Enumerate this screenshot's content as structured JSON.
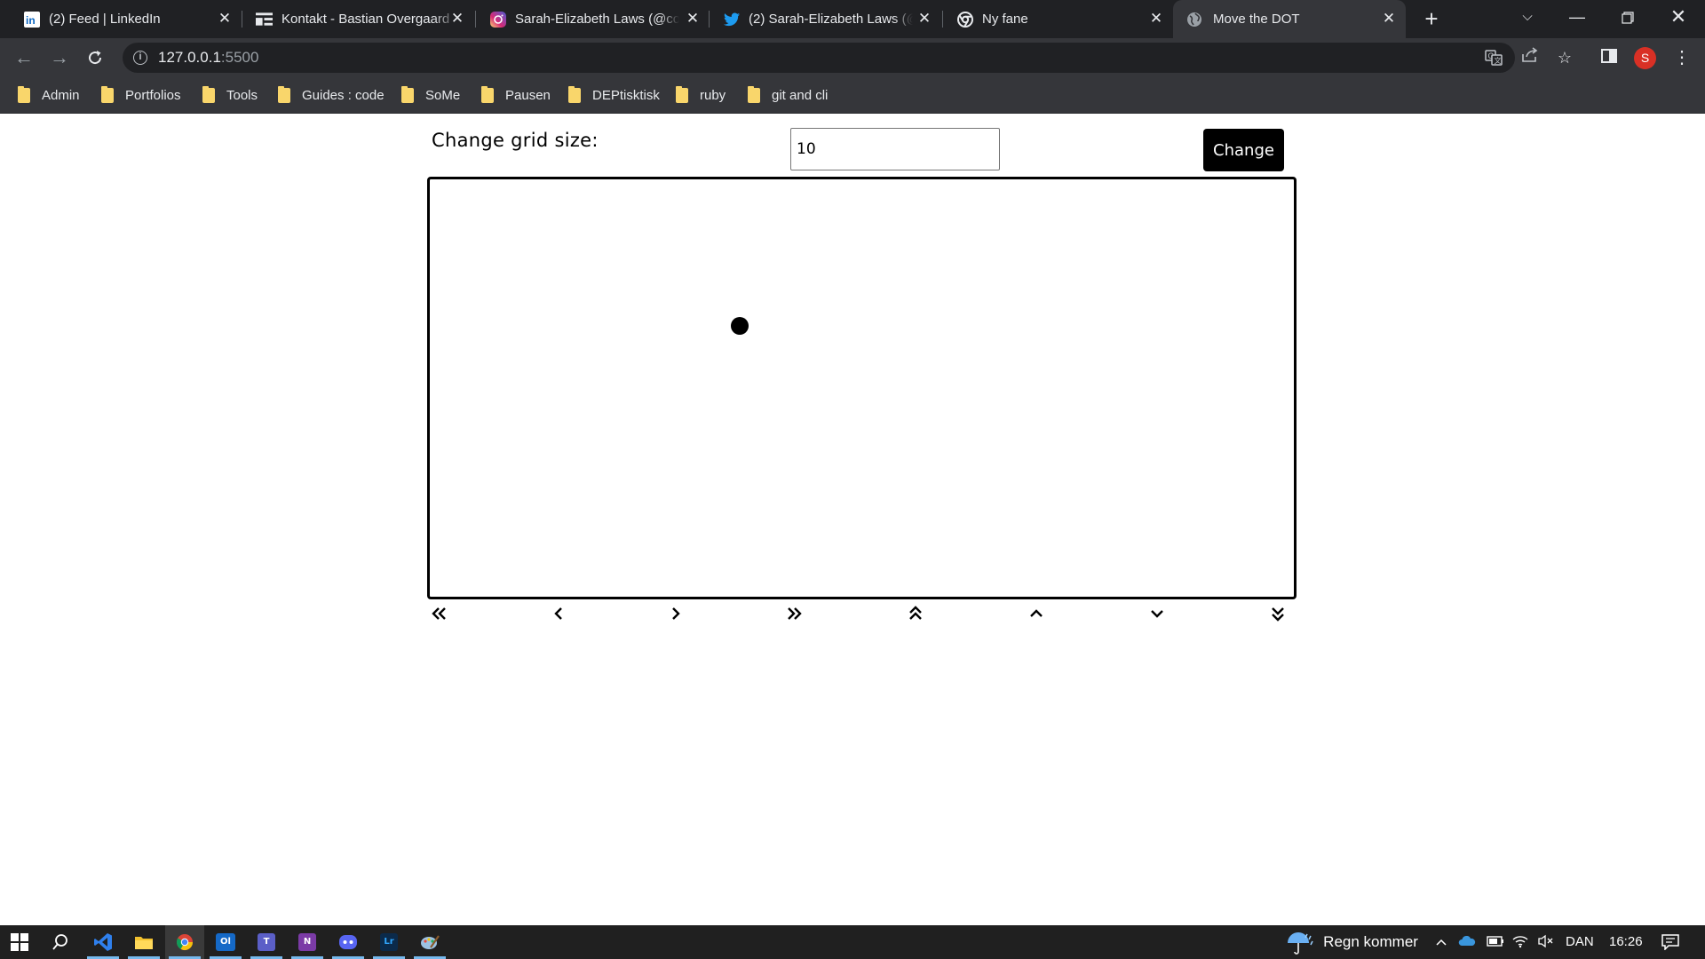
{
  "browser": {
    "tabs": [
      {
        "title": "(2) Feed | LinkedIn",
        "icon": "linkedin-icon",
        "active": false
      },
      {
        "title": "Kontakt - Bastian Overgaard",
        "icon": "site-icon",
        "active": false
      },
      {
        "title": "Sarah-Elizabeth Laws (@coc",
        "icon": "instagram-icon",
        "active": false
      },
      {
        "title": "(2) Sarah-Elizabeth Laws (@",
        "icon": "twitter-icon",
        "active": false
      },
      {
        "title": "Ny fane",
        "icon": "chrome-icon",
        "active": false
      },
      {
        "title": "Move the DOT",
        "icon": "globe-icon",
        "active": true
      }
    ],
    "url_host": "127.0.0.1",
    "url_port": ":5500",
    "profile_initial": "S",
    "bookmarks": [
      "Admin",
      "Portfolios",
      "Tools",
      "Guides : code",
      "SoMe",
      "Pausen",
      "DEPtisktisk",
      "ruby",
      "git and cli"
    ]
  },
  "app": {
    "grid_label": "Change grid size:",
    "grid_value": "10",
    "change_button": "Change",
    "dot_position": {
      "col": 3,
      "row": 3
    },
    "controls": [
      {
        "name": "jump-left-button",
        "icon": "double-chevron-left-icon"
      },
      {
        "name": "move-left-button",
        "icon": "chevron-left-icon"
      },
      {
        "name": "move-right-button",
        "icon": "chevron-right-icon"
      },
      {
        "name": "jump-right-button",
        "icon": "double-chevron-right-icon"
      },
      {
        "name": "jump-up-button",
        "icon": "double-chevron-up-icon"
      },
      {
        "name": "move-up-button",
        "icon": "chevron-up-icon"
      },
      {
        "name": "move-down-button",
        "icon": "chevron-down-icon"
      },
      {
        "name": "jump-down-button",
        "icon": "double-chevron-down-icon"
      }
    ]
  },
  "taskbar": {
    "weather": "Regn kommer",
    "language": "DAN",
    "time": "16:26",
    "apps": [
      {
        "name": "vscode",
        "label": "VS",
        "color": "#2f80ed"
      },
      {
        "name": "file-explorer",
        "label": "",
        "color": "#f2c12e"
      },
      {
        "name": "chrome",
        "label": "",
        "color": "#34a853"
      },
      {
        "name": "outlook",
        "label": "Ol",
        "color": "#1569c7"
      },
      {
        "name": "teams",
        "label": "T",
        "color": "#5b5fc7"
      },
      {
        "name": "onenote",
        "label": "N",
        "color": "#7b3ba6"
      },
      {
        "name": "discord",
        "label": "D",
        "color": "#5865f2"
      },
      {
        "name": "lightroom",
        "label": "Lr",
        "color": "#0b2a4a"
      },
      {
        "name": "paint",
        "label": "P",
        "color": "#6a9ac4"
      }
    ]
  },
  "colors": {
    "tabstrip": "#202124",
    "toolbar": "#35363a",
    "folder": "#f9d66b",
    "button": "#000000",
    "taskbar": "#202020",
    "taskbar_indicator": "#76b9ed"
  }
}
